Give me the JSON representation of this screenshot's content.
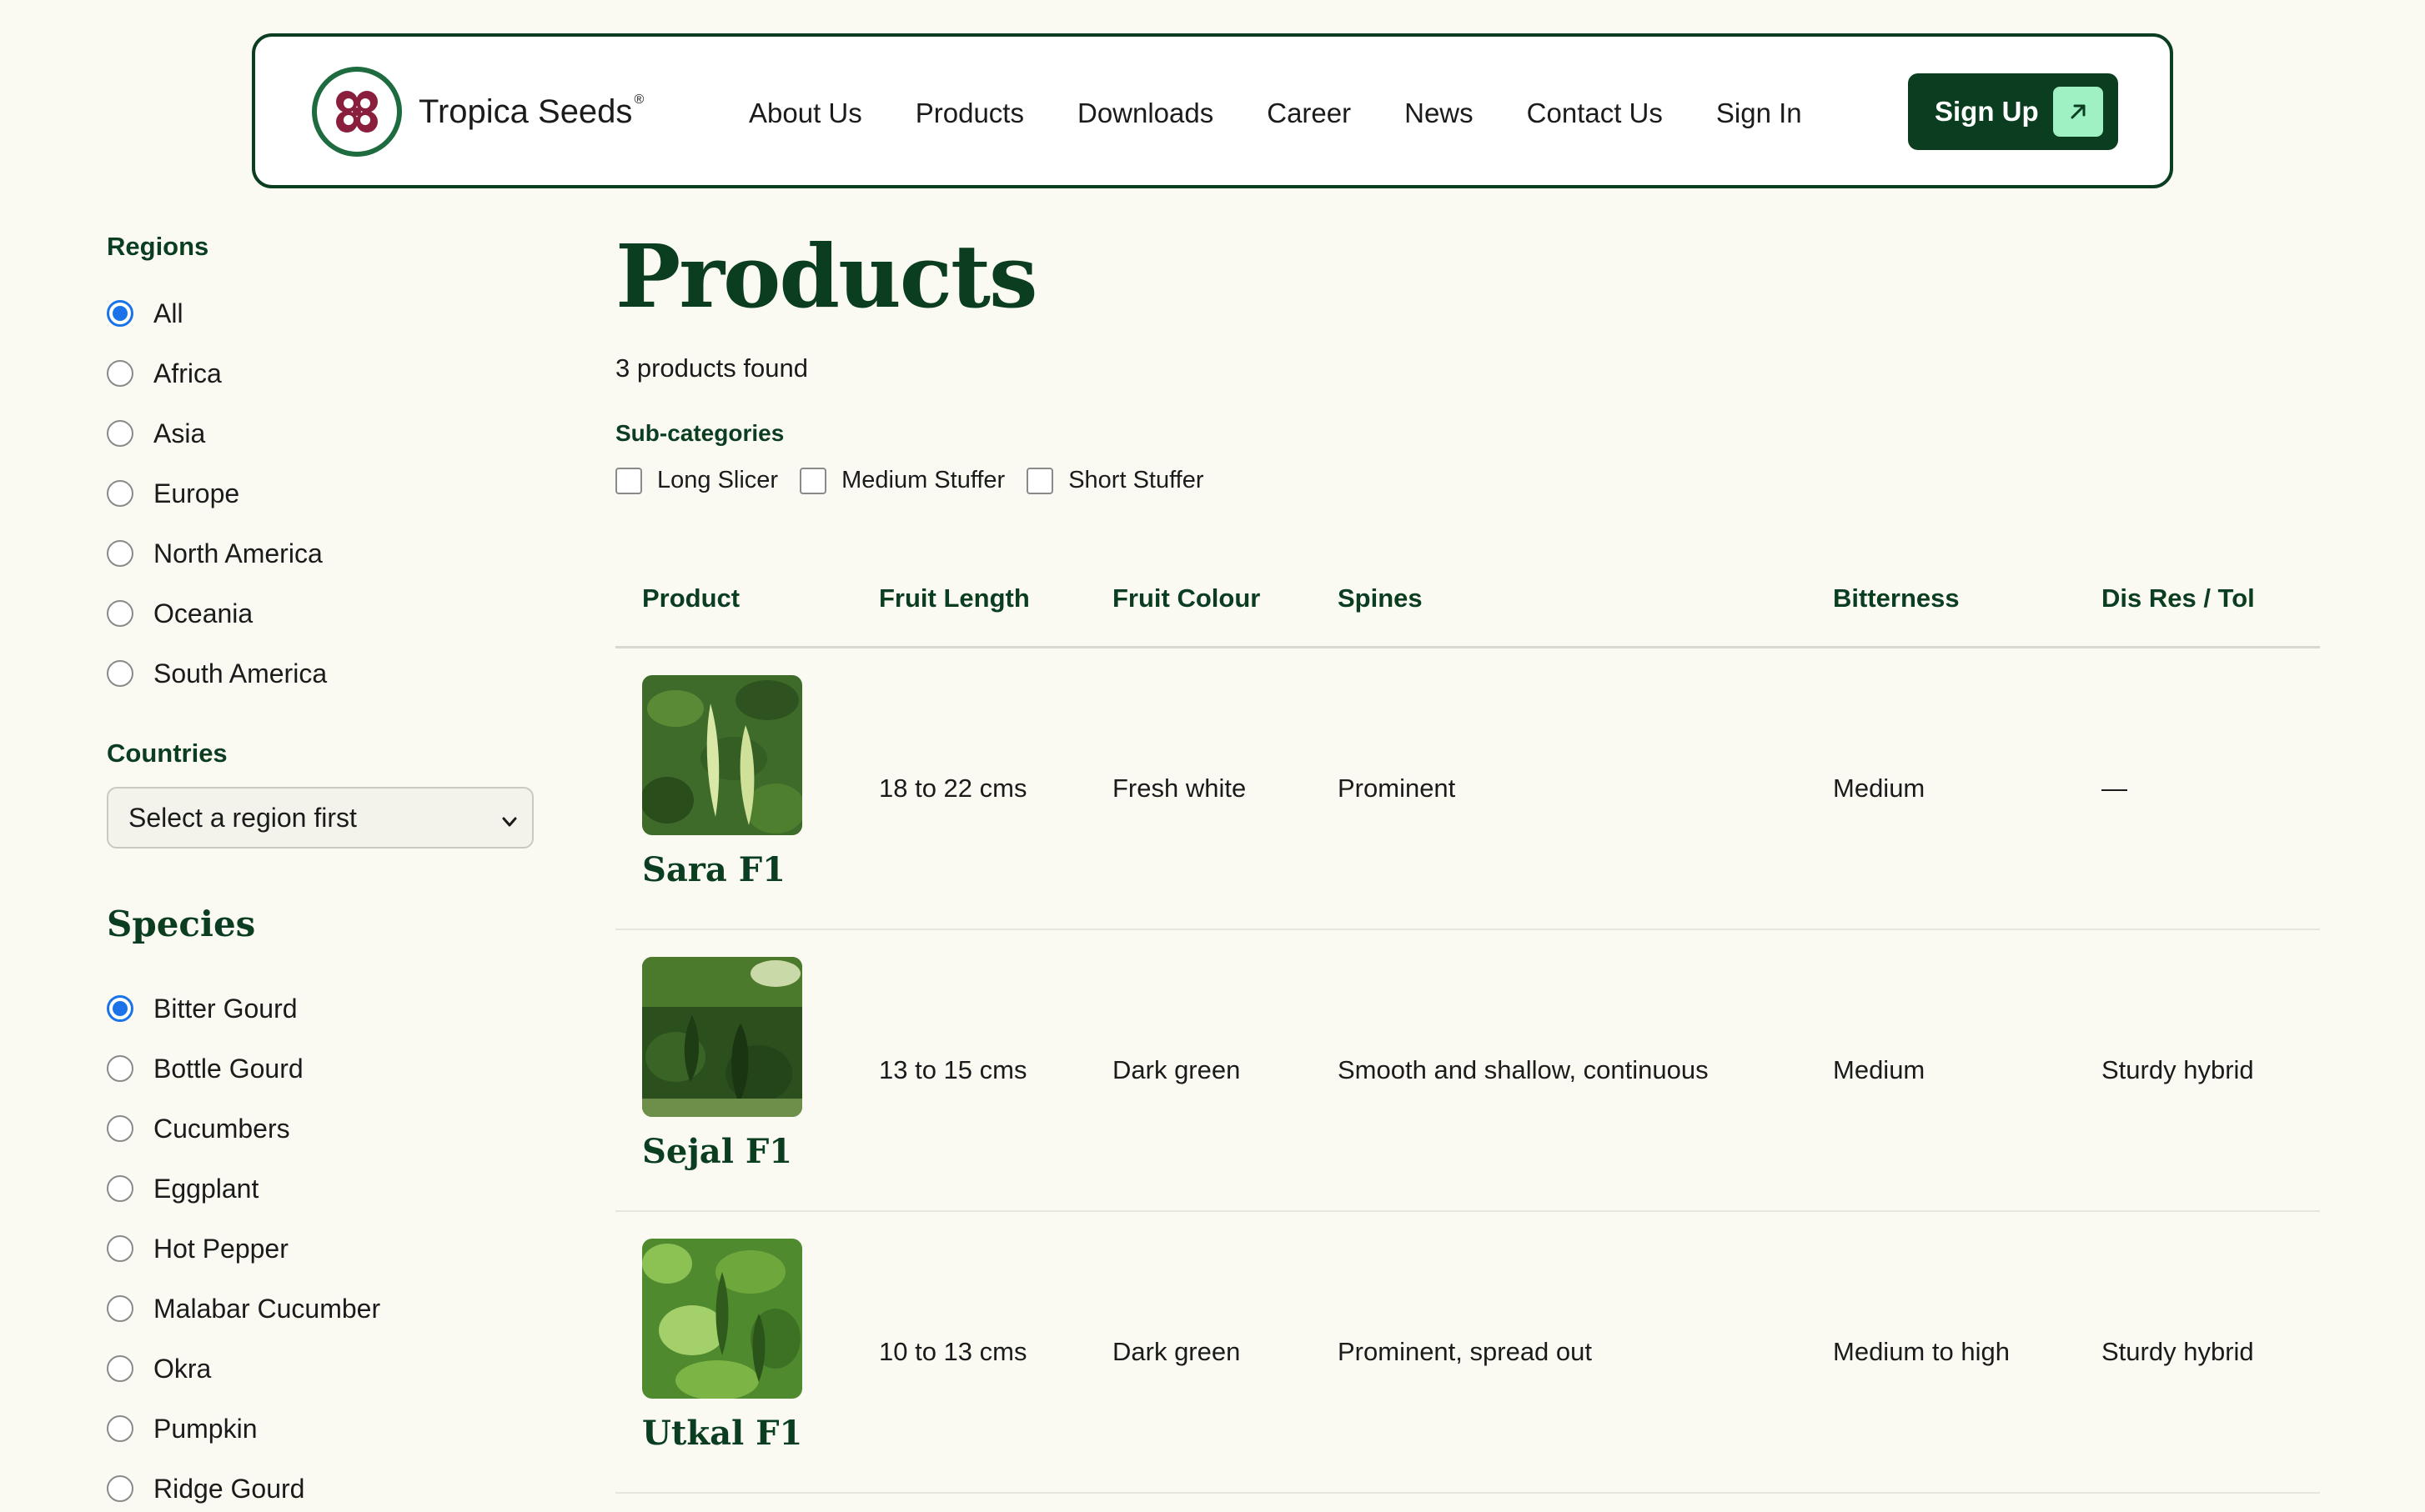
{
  "brand": {
    "name": "Tropica Seeds",
    "trademark": "®"
  },
  "nav": {
    "items": [
      "About Us",
      "Products",
      "Downloads",
      "Career",
      "News",
      "Contact Us",
      "Sign In"
    ],
    "cta_label": "Sign Up"
  },
  "sidebar": {
    "regions_heading": "Regions",
    "regions": [
      {
        "label": "All",
        "checked": true
      },
      {
        "label": "Africa",
        "checked": false
      },
      {
        "label": "Asia",
        "checked": false
      },
      {
        "label": "Europe",
        "checked": false
      },
      {
        "label": "North America",
        "checked": false
      },
      {
        "label": "Oceania",
        "checked": false
      },
      {
        "label": "South America",
        "checked": false
      }
    ],
    "countries_heading": "Countries",
    "countries_select_value": "Select a region first",
    "species_heading": "Species",
    "species": [
      {
        "label": "Bitter Gourd",
        "checked": true
      },
      {
        "label": "Bottle Gourd",
        "checked": false
      },
      {
        "label": "Cucumbers",
        "checked": false
      },
      {
        "label": "Eggplant",
        "checked": false
      },
      {
        "label": "Hot Pepper",
        "checked": false
      },
      {
        "label": "Malabar Cucumber",
        "checked": false
      },
      {
        "label": "Okra",
        "checked": false
      },
      {
        "label": "Pumpkin",
        "checked": false
      },
      {
        "label": "Ridge Gourd",
        "checked": false
      }
    ]
  },
  "main": {
    "title": "Products",
    "found_text": "3 products found",
    "subcategories_heading": "Sub-categories",
    "subcategories": [
      "Long Slicer",
      "Medium Stuffer",
      "Short Stuffer"
    ],
    "columns": [
      "Product",
      "Fruit Length",
      "Fruit Colour",
      "Spines",
      "Bitterness",
      "Dis Res / Tol"
    ],
    "rows": [
      {
        "name": "Sara F1",
        "length": "18 to 22 cms",
        "colour": "Fresh white",
        "spines": "Prominent",
        "bitterness": "Medium",
        "disres": "—"
      },
      {
        "name": "Sejal F1",
        "length": "13 to 15 cms",
        "colour": "Dark green",
        "spines": "Smooth and shallow, continuous",
        "bitterness": "Medium",
        "disres": "Sturdy hybrid"
      },
      {
        "name": "Utkal F1",
        "length": "10 to 13 cms",
        "colour": "Dark green",
        "spines": "Prominent, spread out",
        "bitterness": "Medium to high",
        "disres": "Sturdy hybrid"
      }
    ]
  },
  "colors": {
    "brand_dark": "#0b3d20",
    "accent_mint": "#9ff0c3",
    "background": "#fafaf3",
    "radio_blue": "#1a73e8"
  },
  "icons": {
    "logo": "clover-logo-icon",
    "signup_arrow": "arrow-up-right-icon",
    "select_chevron": "chevron-down-icon"
  }
}
